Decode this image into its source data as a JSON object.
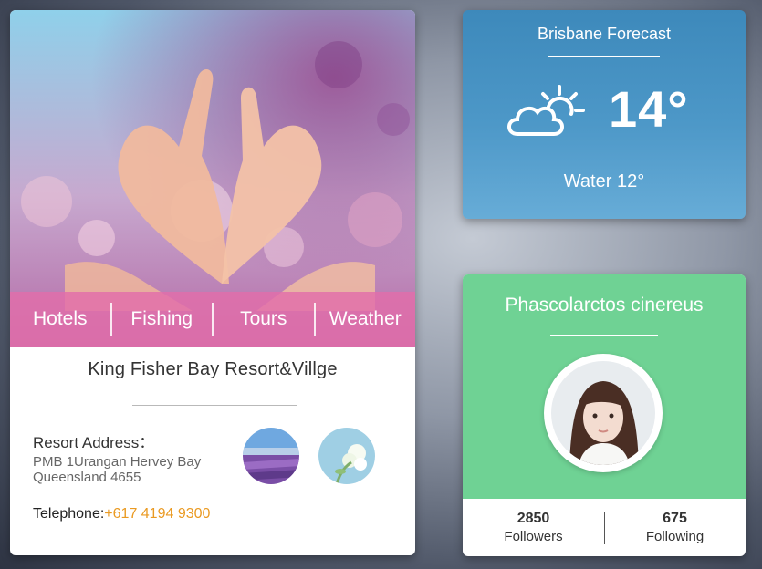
{
  "resort": {
    "nav": [
      {
        "label": "Hotels"
      },
      {
        "label": "Fishing"
      },
      {
        "label": "Tours"
      },
      {
        "label": "Weather"
      }
    ],
    "name": "King Fisher Bay Resort&Villge",
    "address_label": "Resort Address：",
    "address_line1": "PMB 1Urangan Hervey Bay",
    "address_line2": "Queensland 4655",
    "telephone_label": "Telephone:",
    "telephone_number": "+617 4194 9300"
  },
  "weather": {
    "title": "Brisbane Forecast",
    "temperature": "14°",
    "water": "Water 12°",
    "icon": "cloud-sun-icon"
  },
  "profile": {
    "name": "Phascolarctos cinereus",
    "followers_count": "2850",
    "followers_label": "Followers",
    "following_count": "675",
    "following_label": "Following"
  },
  "colors": {
    "nav_bar": "#e26eaa",
    "phone_accent": "#ea9a22",
    "weather_bg": "#4d98c8",
    "profile_bg": "#6fd294"
  }
}
